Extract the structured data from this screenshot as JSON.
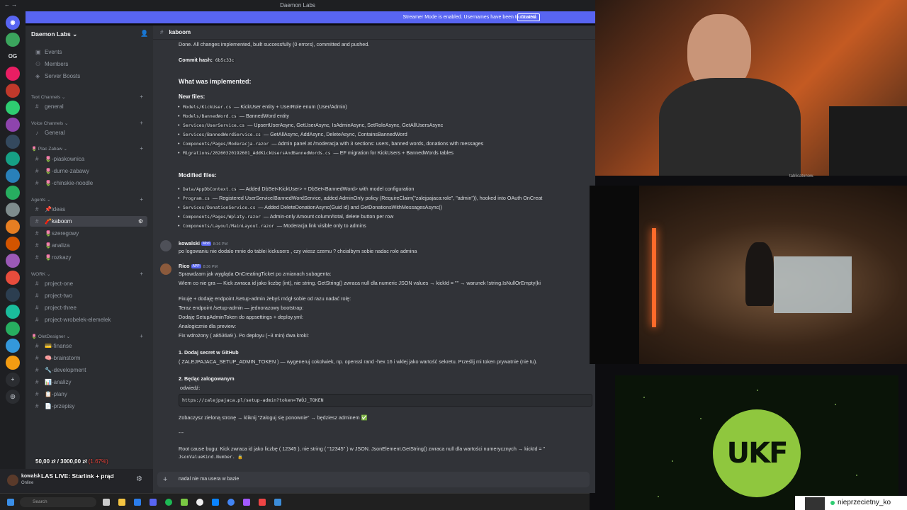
{
  "titlebar": {
    "title": "Daemon Labs",
    "nav": "←→"
  },
  "banner": {
    "text": "Streamer Mode is enabled. Usernames have been truncated.",
    "button": "Disable"
  },
  "server": {
    "name": "Daemon Labs ⌄"
  },
  "servers": [
    {
      "label": "OG",
      "color": "#1e1f22"
    },
    {
      "label": "",
      "color": "#5865f2"
    },
    {
      "label": "",
      "color": "#d9534f"
    },
    {
      "label": "",
      "color": "#3ba55d"
    }
  ],
  "channels": {
    "top": [
      "Events",
      "Members",
      "Server Boosts"
    ],
    "categories": {
      "text": "Text Channels ⌄",
      "voice": "Voice Channels ⌄",
      "plac": "🌷 Plac Zabaw ⌄",
      "agents": "Agents ⌄",
      "work": "WORK ⌄",
      "olet": "🌷 OletDesigner ⌄"
    },
    "text_channels": [
      "general"
    ],
    "voice_channels": [
      "General"
    ],
    "plac_channels": [
      "🌷-piaskownica",
      "🌷-durne-zabawy",
      "🌷-chinskie-noodle"
    ],
    "agent_channels": [
      "📌ideas",
      "🧨kaboom",
      "🌷szeregowy",
      "🌷analiza",
      "🌷rozkazy"
    ],
    "work_channels": [
      "project-one",
      "project-two",
      "project-three",
      "project-wrobelek-elemelek"
    ],
    "olet_channels": [
      "💳-finanse",
      "🧠-brainstorm",
      "🔧-development",
      "📊-analizy",
      "📋-plany",
      "📄-przepisy"
    ]
  },
  "chat_header": {
    "channel": "kaboom"
  },
  "messages": {
    "done": "Done. All changes implemented, built successfully (0 errors), committed and pushed.",
    "commit_label": "Commit hash:",
    "commit_hash": "6b5c33c",
    "what_title": "What was implemented:",
    "new_files_title": "New files:",
    "new_files": [
      {
        "file": "Models/KickUser.cs",
        "desc": "— KickUser entity + UserRole enum (User/Admin)"
      },
      {
        "file": "Models/BannedWord.cs",
        "desc": "— BannedWord entity"
      },
      {
        "file": "Services/UserService.cs",
        "desc": "— UpsertUserAsync, GetUserAsync, IsAdminAsync, SetRoleAsync, GetAllUsersAsync"
      },
      {
        "file": "Services/BannedWordService.cs",
        "desc": "— GetAllAsync, AddAsync, DeleteAsync, ContainsBannedWord"
      },
      {
        "file": "Components/Pages/Moderacja.razor",
        "desc": "— Admin panel at /moderacja with 3 sections: users, banned words, donations with messages"
      },
      {
        "file": "Migrations/20260320192601_AddKickUsersAndBannedWords.cs",
        "desc": "— EF migration for KickUsers + BannedWords tables"
      }
    ],
    "modified_title": "Modified files:",
    "modified_files": [
      {
        "file": "Data/AppDbContext.cs",
        "desc": "— Added DbSet<KickUser> + DbSet<BannedWord> with model configuration"
      },
      {
        "file": "Program.cs",
        "desc": "— Registered UserService/BannedWordService, added AdminOnly policy (RequireClaim(\"zalejpajaca:role\", \"admin\")), hooked into OAuth OnCreat"
      },
      {
        "file": "Services/DonationService.cs",
        "desc": "— Added DeleteDonationAsync(Guid id) and GetDonationsWithMessagesAsync()"
      },
      {
        "file": "Components/Pages/Wplaty.razor",
        "desc": "— Admin-only Amount column/total, delete button per row"
      },
      {
        "file": "Components/Layout/MainLayout.razor",
        "desc": "— Moderacja link visible only to admins"
      }
    ],
    "user1": {
      "name": "kowalski",
      "tag": "Mod",
      "time": "8:36 PM",
      "text": "po logowaniu nie dodalo mnie do tablei kickusers , czy wiesz czemu ? chcialbym sobie nadac role admina"
    },
    "bot": {
      "name": "Rico",
      "tag": "APP",
      "time": "8:36 PM"
    },
    "bot_lines": [
      "Sprawdzam jak wygląda OnCreatingTicket po zmianach subagenta:",
      "Wiem co nie gra — Kick zwraca id jako liczbę (int), nie string. GetString() zwraca null dla numeric JSON values → kickId = \"\" → warunek !string.IsNullOrEmpty(ki",
      "Fixuję + dodaję endpoint /setup-admin żebyś mógł sobie od razu nadać rolę:",
      "Teraz endpoint /setup-admin — jednorazowy bootstrap:",
      "Dodaję SetupAdminToken do appsettings + deploy.yml:",
      "Analogicznie dla preview:",
      "Fix wdrożony ( a8536a9 ). Po deployu (~3 min) dwa kroki:",
      "1. Dodaj secret w GitHub",
      "( ZALEJPAJACA_SETUP_ADMIN_TOKEN ) — wygeneruj cokolwiek, np. openssl rand -hex 16 i wklej jako wartość sekretu. Prześlij mi token prywatnie (nie tu).",
      "2. Będąc zalogowanym",
      "odwiedź:",
      "https://zalejpajaca.pl/setup-admin?token=TWÓJ_TOKEN",
      "Zobaczysz zieloną stronę → kliknij \"Zaloguj się ponownie\" → będziesz adminem ✅",
      "---",
      "Root cause bugu: Kick zwraca id jako liczbę ( 12345 ), nie string ( \"12345\" ) w JSON. JsonElement.GetString() zwraca null dla wartości numerycznych → kickId = ''",
      "JsonValueKind.Number. 🔒"
    ]
  },
  "input": {
    "value": "nadal nie ma usera w bazie"
  },
  "user_panel": {
    "name": "kowalsk",
    "status": "Online"
  },
  "overlay": {
    "stream_title": "LAS LIVE: Starlink + prąd",
    "donation_current": "50,00 zł",
    "donation_goal": "3000,00 zł",
    "donation_pct": "(1.67%)"
  },
  "taskbar": {
    "search": "Search"
  },
  "webcam": {
    "caption": "tablicatonow."
  },
  "ukf": {
    "logo": "UKF"
  },
  "chatter": {
    "name": "nieprzecietny_ko"
  },
  "colors": {
    "accent": "#5865f2",
    "ukf": "#8fc73e"
  }
}
